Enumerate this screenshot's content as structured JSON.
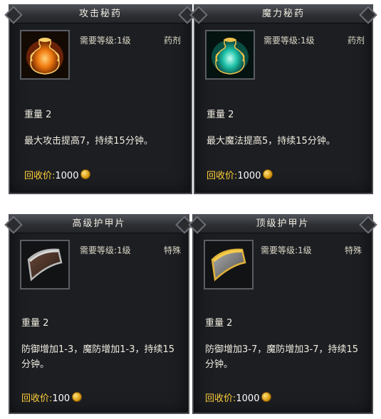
{
  "cards": [
    {
      "title": "攻击秘药",
      "requirement": "需要等级:1级",
      "category": "药剂",
      "weight": "重量 2",
      "description": "最大攻击提高7，持续15分钟。",
      "price_label": "回收价:",
      "price_value": "1000",
      "icon": "orange-potion-vase-icon"
    },
    {
      "title": "魔力秘药",
      "requirement": "需要等级:1级",
      "category": "药剂",
      "weight": "重量 2",
      "description": "最大魔法提高5，持续15分钟。",
      "price_label": "回收价:",
      "price_value": "1000",
      "icon": "teal-potion-vase-icon"
    },
    {
      "title": "高级护甲片",
      "requirement": "需要等级:1级",
      "category": "特殊",
      "weight": "重量 2",
      "description": "防御增加1-3，魔防增加1-3，持续15分钟。",
      "price_label": "回收价:",
      "price_value": "100",
      "icon": "bronze-armor-plate-icon"
    },
    {
      "title": "顶级护甲片",
      "requirement": "需要等级:1级",
      "category": "特殊",
      "weight": "重量 2",
      "description": "防御增加3-7，魔防增加3-7，持续15分钟。",
      "price_label": "回收价:",
      "price_value": "1000",
      "icon": "gold-armor-plate-icon"
    }
  ]
}
